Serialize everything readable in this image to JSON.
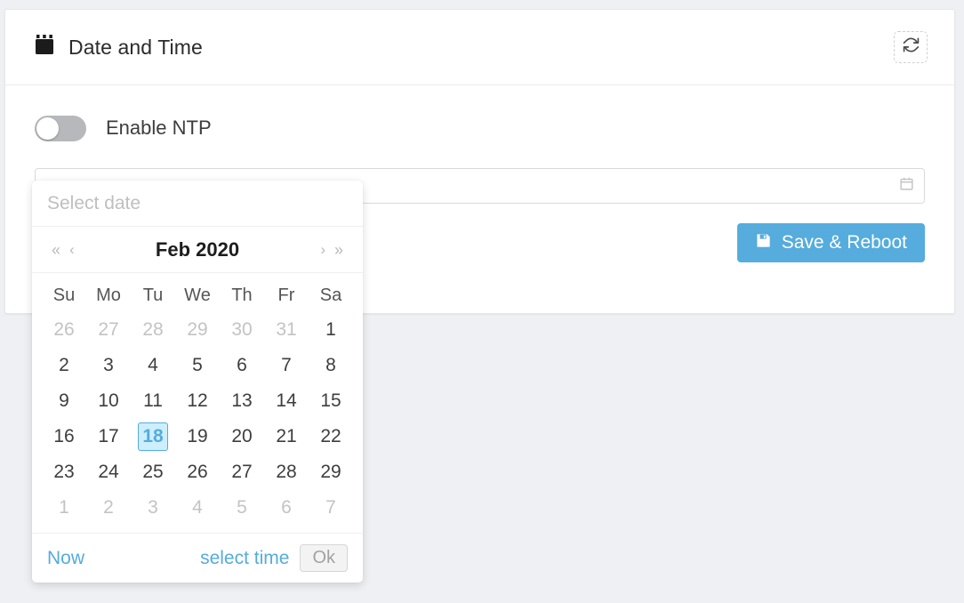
{
  "card": {
    "title": "Date and Time",
    "title_icon": "calendar-icon",
    "refresh_icon": "refresh-icon"
  },
  "settings": {
    "ntp_label": "Enable NTP",
    "ntp_enabled": false,
    "date_value": "",
    "date_placeholder": "",
    "date_field_icon": "calendar-icon"
  },
  "actions": {
    "save_label": "Save & Reboot",
    "save_icon": "save-icon",
    "save_color": "#55acdd"
  },
  "picker": {
    "input_placeholder": "Select date",
    "month_label": "Feb 2020",
    "nav": {
      "prev_year": "«",
      "prev_month": "‹",
      "next_month": "›",
      "next_year": "»"
    },
    "weekdays": [
      "Su",
      "Mo",
      "Tu",
      "We",
      "Th",
      "Fr",
      "Sa"
    ],
    "weeks": [
      [
        {
          "d": "26",
          "muted": true
        },
        {
          "d": "27",
          "muted": true
        },
        {
          "d": "28",
          "muted": true
        },
        {
          "d": "29",
          "muted": true
        },
        {
          "d": "30",
          "muted": true
        },
        {
          "d": "31",
          "muted": true
        },
        {
          "d": "1",
          "muted": false
        }
      ],
      [
        {
          "d": "2",
          "muted": false
        },
        {
          "d": "3",
          "muted": false
        },
        {
          "d": "4",
          "muted": false
        },
        {
          "d": "5",
          "muted": false
        },
        {
          "d": "6",
          "muted": false
        },
        {
          "d": "7",
          "muted": false
        },
        {
          "d": "8",
          "muted": false
        }
      ],
      [
        {
          "d": "9",
          "muted": false
        },
        {
          "d": "10",
          "muted": false
        },
        {
          "d": "11",
          "muted": false
        },
        {
          "d": "12",
          "muted": false
        },
        {
          "d": "13",
          "muted": false
        },
        {
          "d": "14",
          "muted": false
        },
        {
          "d": "15",
          "muted": false
        }
      ],
      [
        {
          "d": "16",
          "muted": false
        },
        {
          "d": "17",
          "muted": false
        },
        {
          "d": "18",
          "muted": false,
          "today": true
        },
        {
          "d": "19",
          "muted": false
        },
        {
          "d": "20",
          "muted": false
        },
        {
          "d": "21",
          "muted": false
        },
        {
          "d": "22",
          "muted": false
        }
      ],
      [
        {
          "d": "23",
          "muted": false
        },
        {
          "d": "24",
          "muted": false
        },
        {
          "d": "25",
          "muted": false
        },
        {
          "d": "26",
          "muted": false
        },
        {
          "d": "27",
          "muted": false
        },
        {
          "d": "28",
          "muted": false
        },
        {
          "d": "29",
          "muted": false
        }
      ],
      [
        {
          "d": "1",
          "muted": true
        },
        {
          "d": "2",
          "muted": true
        },
        {
          "d": "3",
          "muted": true
        },
        {
          "d": "4",
          "muted": true
        },
        {
          "d": "5",
          "muted": true
        },
        {
          "d": "6",
          "muted": true
        },
        {
          "d": "7",
          "muted": true
        }
      ]
    ],
    "footer": {
      "now_label": "Now",
      "select_time_label": "select time",
      "ok_label": "Ok",
      "ok_disabled": true
    },
    "today_color": "#55acdd",
    "today_bg": "#cdeefc"
  }
}
